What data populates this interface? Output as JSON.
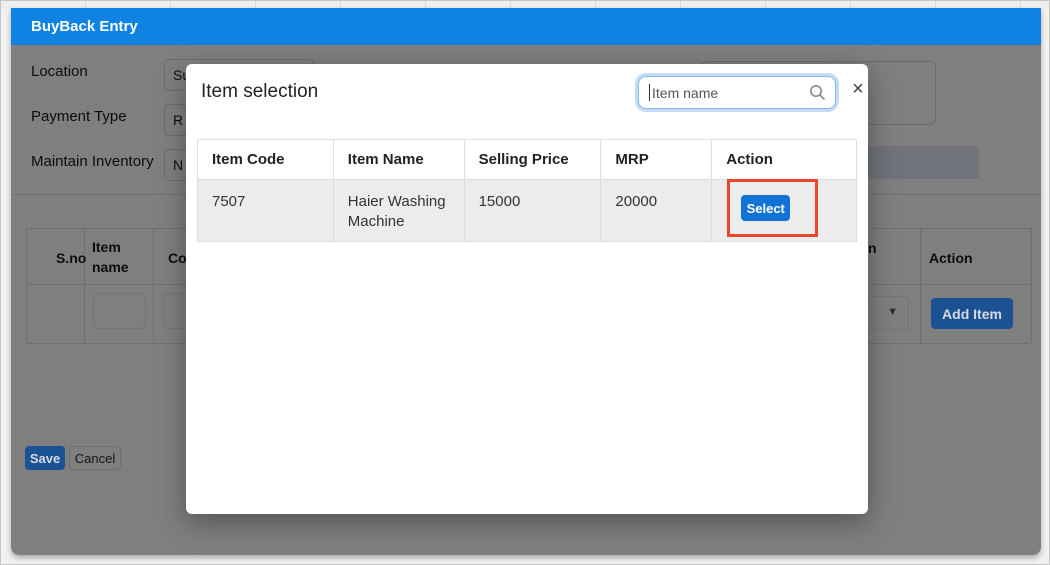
{
  "window": {
    "title": "BuyBack Entry"
  },
  "form": {
    "fields": [
      {
        "label": "Location",
        "visible_value": "Su"
      },
      {
        "label": "Payment Type",
        "visible_value": "R"
      },
      {
        "label": "Maintain Inventory",
        "visible_value": "N"
      }
    ]
  },
  "entry_table": {
    "columns": [
      "S.no",
      "Item name",
      "Co",
      "n",
      "Action"
    ],
    "add_item_label": "Add Item"
  },
  "actions": {
    "save_label": "Save",
    "cancel_label": "Cancel"
  },
  "modal": {
    "title": "Item selection",
    "search_placeholder": "Item name",
    "close_label": "×",
    "table": {
      "columns": [
        "Item Code",
        "Item Name",
        "Selling Price",
        "MRP",
        "Action"
      ],
      "rows": [
        {
          "item_code": "7507",
          "item_name": "Haier Washing Machine",
          "selling_price": "15000",
          "mrp": "20000",
          "action_label": "Select"
        }
      ]
    }
  },
  "colors": {
    "header_blue": "#1082e2",
    "action_blue": "#1273d4",
    "annotation_red": "#e8472b"
  }
}
